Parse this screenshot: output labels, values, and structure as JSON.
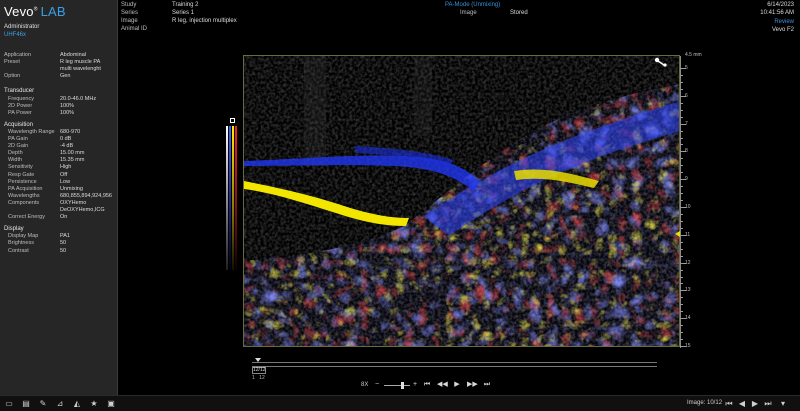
{
  "app": {
    "brand": "Vevo",
    "brand_suffix": "LAB",
    "user": "Administrator",
    "device": "UHF46x"
  },
  "sidebar": {
    "general": [
      {
        "k": "Application",
        "v": "Abdominal"
      },
      {
        "k": "Preset",
        "v": "R leg muscle PA"
      },
      {
        "k": "",
        "v": "multi wavelenght"
      },
      {
        "k": "Option",
        "v": "Gen"
      }
    ],
    "transducer_title": "Transducer",
    "transducer": [
      {
        "k": "Frequency",
        "v": "20.0-46.0 MHz"
      },
      {
        "k": "2D Power",
        "v": "100%"
      },
      {
        "k": "PA Power",
        "v": "100%"
      }
    ],
    "acquisition_title": "Acquisition",
    "acquisition": [
      {
        "k": "Wavelength Range",
        "v": "680-970"
      },
      {
        "k": "PA Gain",
        "v": "0 dB"
      },
      {
        "k": "2D Gain",
        "v": "-4 dB"
      },
      {
        "k": "Depth",
        "v": "15.00 mm"
      },
      {
        "k": "Width",
        "v": "15.35 mm"
      },
      {
        "k": "Sensitivity",
        "v": "High"
      },
      {
        "k": "Resp Gate",
        "v": "Off"
      },
      {
        "k": "Persistence",
        "v": "Low"
      },
      {
        "k": "PA Acquisition",
        "v": "Unmixing"
      },
      {
        "k": "Wavelengths",
        "v": "680,855,894,924,956"
      },
      {
        "k": "Components",
        "v": "OXYHemo"
      },
      {
        "k": "",
        "v": "DeOXYHemo,ICG"
      },
      {
        "k": "Correct Energy",
        "v": "On"
      }
    ],
    "display_title": "Display",
    "display": [
      {
        "k": "Display Map",
        "v": "PA1"
      },
      {
        "k": "Brightness",
        "v": "50"
      },
      {
        "k": "Contrast",
        "v": "50"
      }
    ]
  },
  "header": {
    "study_label": "Study",
    "study": "Training 2",
    "series_label": "Series",
    "series": "Series 1",
    "image_label": "Image",
    "image": "R leg, injection multiplex",
    "animal_label": "Animal ID",
    "mode": "PA-Mode (Unmixing)",
    "image_status_label": "Image",
    "image_status": "Stored",
    "date": "6/14/2023",
    "time": "10:41:56 AM",
    "review": "Review",
    "system": "Vevo F2"
  },
  "depth_axis": {
    "unit": "4.5 mm",
    "ticks": [
      "5",
      "6",
      "7",
      "8",
      "9",
      "10",
      "11",
      "12",
      "13",
      "14",
      "15"
    ]
  },
  "playback": {
    "frame": "12/12",
    "range_start": "1",
    "range_end": "12",
    "speed": "8X"
  },
  "footer": {
    "image_counter": "Image: 10/12"
  },
  "colors": {
    "oxy": "#e01010",
    "deoxy": "#2a3cff",
    "icg": "#f0e000",
    "accent": "#3aa0e6"
  }
}
